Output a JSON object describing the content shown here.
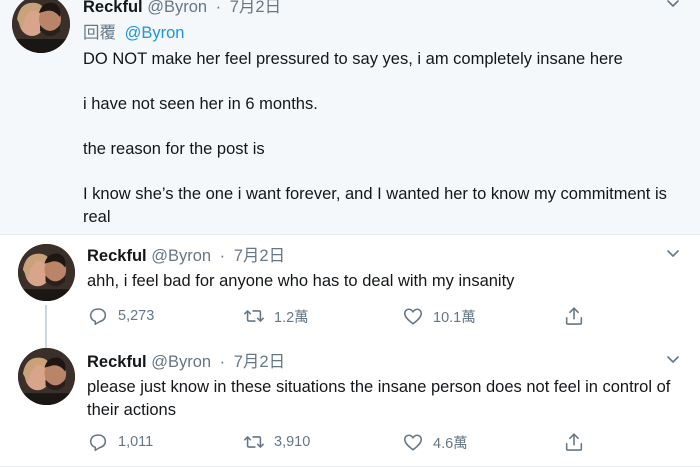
{
  "tweets": [
    {
      "name": "Reckful",
      "handle": "@Byron",
      "separator": "·",
      "date": "7月2日",
      "reply_label": "回覆",
      "reply_handle": "@Byron",
      "paragraphs": [
        "DO NOT make her feel pressured to say yes, i am completely insane here",
        "i have not seen her in 6 months.",
        "the reason for the post is",
        "I know she’s the one i want forever, and I wanted her to know my commitment is real"
      ]
    },
    {
      "name": "Reckful",
      "handle": "@Byron",
      "separator": "·",
      "date": "7月2日",
      "paragraphs": [
        "ahh, i feel bad for anyone who has to deal with my insanity"
      ],
      "actions": {
        "replies": "5,273",
        "retweets": "1.2萬",
        "likes": "10.1萬"
      }
    },
    {
      "name": "Reckful",
      "handle": "@Byron",
      "separator": "·",
      "date": "7月2日",
      "paragraphs": [
        "please just know in these situations the insane person does not feel in control of their actions"
      ],
      "actions": {
        "replies": "1,011",
        "retweets": "3,910",
        "likes": "4.6萬"
      }
    }
  ],
  "icons": {
    "reply": "reply-icon",
    "retweet": "retweet-icon",
    "like": "heart-icon",
    "share": "share-icon",
    "caret": "chevron-down-icon"
  },
  "colors": {
    "highlight_bg": "#f5f8fa",
    "text": "#14171a",
    "secondary": "#657786",
    "link": "#1b95e0",
    "thread_line": "#ccd6dd"
  }
}
